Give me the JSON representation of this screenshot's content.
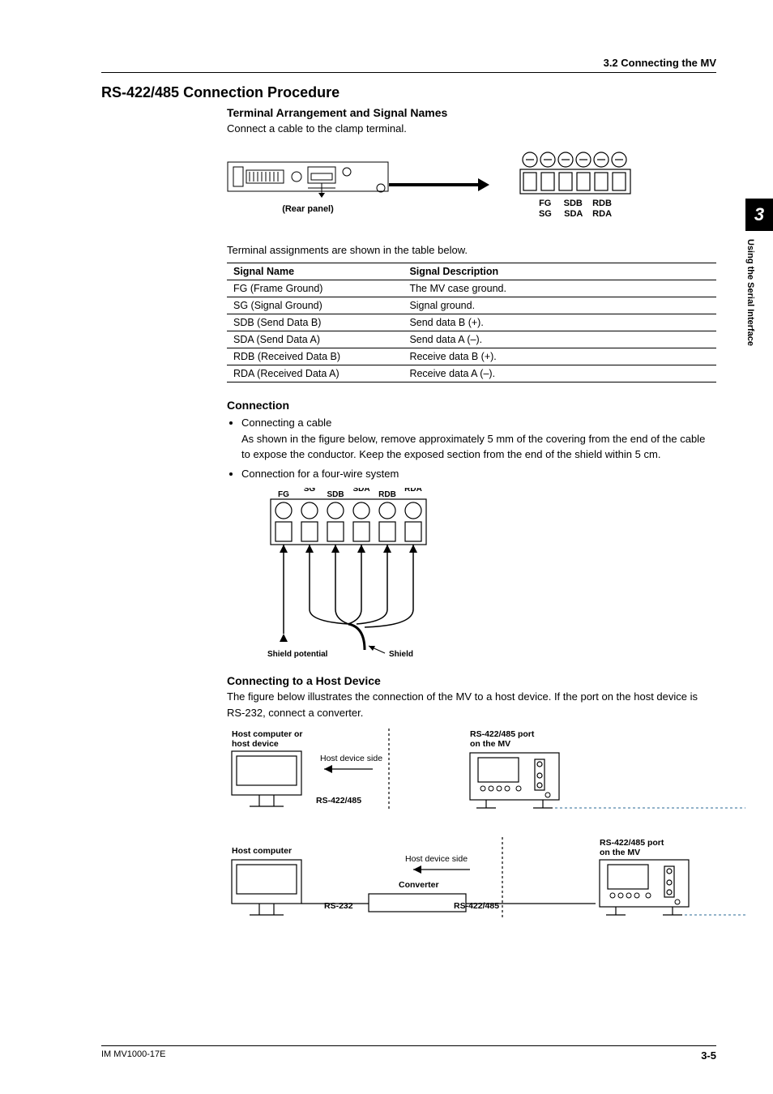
{
  "header": {
    "section_ref": "3.2  Connecting the MV"
  },
  "main": {
    "heading": "RS-422/485 Connection Procedure",
    "terminal": {
      "heading": "Terminal Arrangement and Signal Names",
      "intro": "Connect a cable to the clamp terminal.",
      "rear_caption": "(Rear panel)",
      "labels_line1": "FG     SDB    RDB",
      "labels_line2": "SG     SDA    RDA",
      "table_intro": "Terminal assignments are shown in the table below.",
      "table": {
        "head_name": "Signal Name",
        "head_desc": "Signal Description",
        "rows": [
          {
            "name": "FG (Frame Ground)",
            "desc": "The MV case ground."
          },
          {
            "name": "SG (Signal Ground)",
            "desc": "Signal ground."
          },
          {
            "name": "SDB (Send Data B)",
            "desc": "Send data B (+)."
          },
          {
            "name": "SDA (Send Data A)",
            "desc": "Send data A (–)."
          },
          {
            "name": "RDB (Received Data B)",
            "desc": "Receive data B (+)."
          },
          {
            "name": "RDA (Received Data A)",
            "desc": "Receive data A (–)."
          }
        ]
      }
    },
    "connection": {
      "heading": "Connection",
      "bullet1_title": "Connecting a cable",
      "bullet1_body": "As shown in the figure below, remove approximately 5 mm of the covering from the end of the cable to expose the conductor. Keep the exposed section from the end of the shield within 5 cm.",
      "bullet2_title": "Connection for a four-wire system",
      "wire_labels": {
        "fg": "FG",
        "sg": "SG",
        "sdb": "SDB",
        "sda": "SDA",
        "rdb": "RDB",
        "rda": "RDA"
      },
      "shield_potential": "Shield potential",
      "shield": "Shield"
    },
    "host": {
      "heading": "Connecting to a Host Device",
      "body": "The figure below illustrates the connection of the MV to a host device. If the port on the host device is RS-232, connect a converter.",
      "fig1": {
        "host_label": "Host computer or\nhost device",
        "host_side": "Host device side",
        "bus": "RS-422/485",
        "mv_port": "RS-422/485 port\non the MV"
      },
      "fig2": {
        "host_label": "Host computer",
        "host_side": "Host device side",
        "converter": "Converter",
        "rs232": "RS-232",
        "bus": "RS-422/485",
        "mv_port": "RS-422/485 port\non the MV"
      }
    }
  },
  "sidetab": {
    "chapter": "3",
    "title": "Using the Serial Interface"
  },
  "footer": {
    "doc": "IM MV1000-17E",
    "page": "3-5"
  }
}
